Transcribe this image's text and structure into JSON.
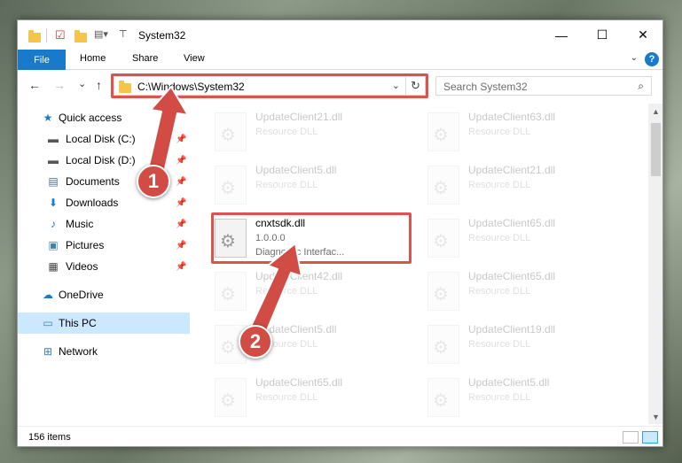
{
  "window": {
    "title": "System32",
    "minimize": "—",
    "maximize": "☐",
    "close": "✕"
  },
  "ribbon": {
    "file": "File",
    "home": "Home",
    "share": "Share",
    "view": "View",
    "help": "?"
  },
  "address": {
    "path": "C:\\Windows\\System32",
    "refresh": "↻",
    "dropdown": "⌄"
  },
  "search": {
    "placeholder": "Search System32",
    "icon": "⌕"
  },
  "nav": {
    "back": "←",
    "forward": "→",
    "recent": "⌄",
    "up": "↑",
    "items": [
      {
        "label": "Quick access",
        "icon": "★"
      },
      {
        "label": "Local Disk (C:)",
        "icon": "▬"
      },
      {
        "label": "Local Disk (D:)",
        "icon": "▬"
      },
      {
        "label": "Documents",
        "icon": "▤"
      },
      {
        "label": "Downloads",
        "icon": "⬇"
      },
      {
        "label": "Music",
        "icon": "♪"
      },
      {
        "label": "Pictures",
        "icon": "▣"
      },
      {
        "label": "Videos",
        "icon": "▦"
      },
      {
        "label": "OneDrive",
        "icon": "☁"
      },
      {
        "label": "This PC",
        "icon": "▭"
      },
      {
        "label": "Network",
        "icon": "⊞"
      }
    ]
  },
  "files": [
    {
      "name": "UpdateClient21.dll",
      "desc": "Resource DLL",
      "desc2": ""
    },
    {
      "name": "UpdateClient63.dll",
      "desc": "Resource DLL",
      "desc2": ""
    },
    {
      "name": "UpdateClient5.dll",
      "desc": "Resource DLL",
      "desc2": ""
    },
    {
      "name": "UpdateClient21.dll",
      "desc": "Resource DLL",
      "desc2": ""
    },
    {
      "name": "cnxtsdk.dll",
      "desc": "1.0.0.0",
      "desc2": "Diagnostic Interfac..."
    },
    {
      "name": "UpdateClient65.dll",
      "desc": "Resource DLL",
      "desc2": ""
    },
    {
      "name": "UpdateClient42.dll",
      "desc": "Resource DLL",
      "desc2": ""
    },
    {
      "name": "UpdateClient65.dll",
      "desc": "Resource DLL",
      "desc2": ""
    },
    {
      "name": "UpdateClient5.dll",
      "desc": "Resource DLL",
      "desc2": ""
    },
    {
      "name": "UpdateClient19.dll",
      "desc": "Resource DLL",
      "desc2": ""
    },
    {
      "name": "UpdateClient65.dll",
      "desc": "Resource DLL",
      "desc2": ""
    },
    {
      "name": "UpdateClient5.dll",
      "desc": "Resource DLL",
      "desc2": ""
    }
  ],
  "status": {
    "items": "156 items"
  },
  "annotations": {
    "step1": "1",
    "step2": "2",
    "color": "#d14c45"
  }
}
